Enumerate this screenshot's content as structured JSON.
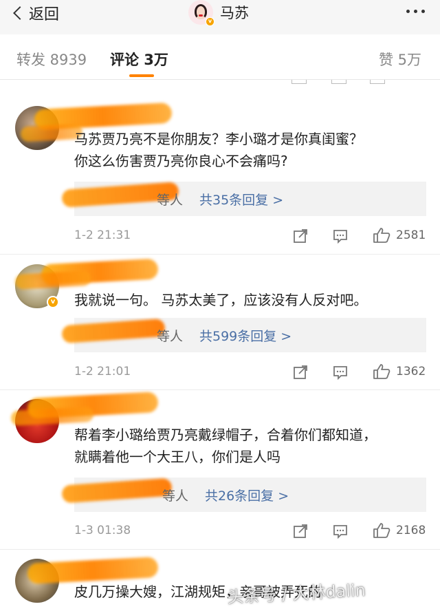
{
  "header": {
    "back_label": "返回",
    "title": "马苏"
  },
  "tabs": {
    "repost": "转发 8939",
    "comments": "评论 3万",
    "likes": "赞 5万"
  },
  "comments": [
    {
      "text_line1": "马苏贾乃亮不是你朋友？李小璐才是你真闺蜜？",
      "text_line2": "你这么伤害贾乃亮你良心不会痛吗?",
      "reply_suffix": "等人",
      "reply_link": "共35条回复 >",
      "time": "1-2 21:31",
      "likes": "2581"
    },
    {
      "text_line1": "我就说一句。 马苏太美了，应该没有人反对吧。",
      "reply_suffix": "等人",
      "reply_link": "共599条回复 >",
      "time": "1-2 21:01",
      "likes": "1362"
    },
    {
      "text_line1": "帮着李小璐给贾乃亮戴绿帽子，合着你们都知道，",
      "text_line2": "就瞒着他一个大王八，你们是人吗",
      "reply_suffix": "等人",
      "reply_link": "共26条回复 >",
      "time": "1-3 01:38",
      "likes": "2168"
    },
    {
      "text_line1": "皮几万操大嫂，江湖规矩，亲哥被弄死的"
    }
  ],
  "watermark": "头条号 / 大林dalin",
  "colors": {
    "accent": "#ff8200",
    "link": "#4a6fa5",
    "verified": "#f7a400"
  }
}
